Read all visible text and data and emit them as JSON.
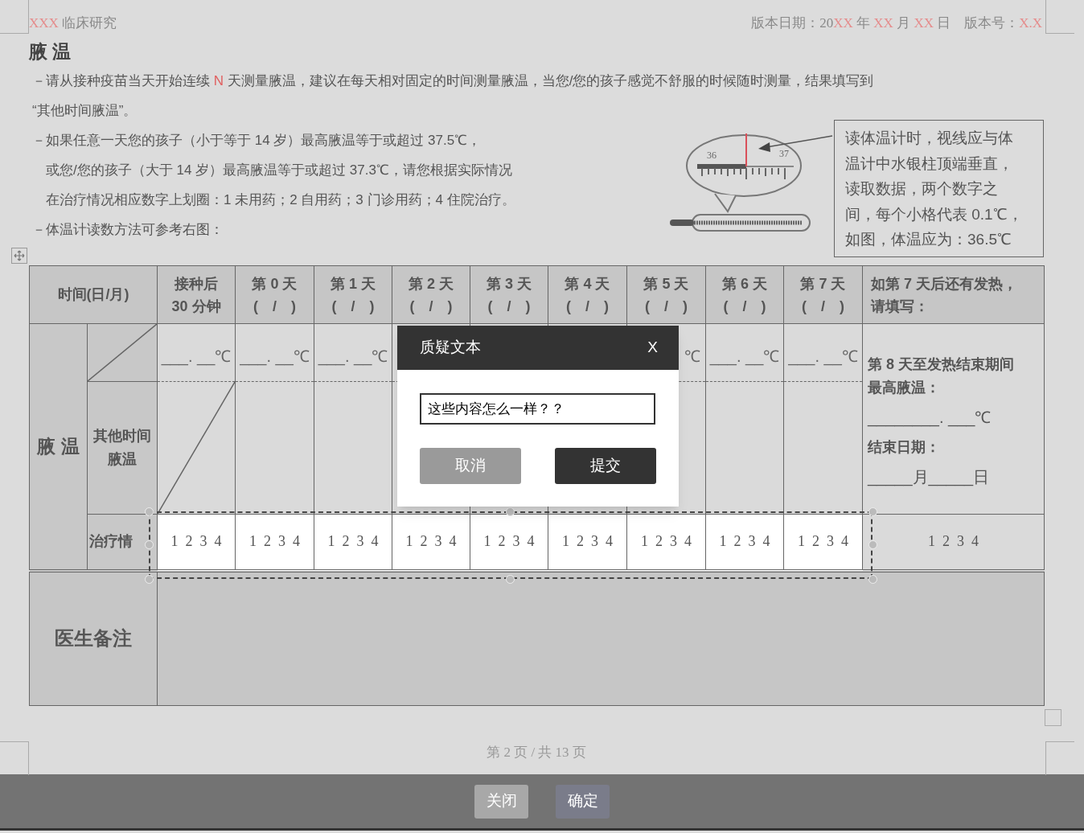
{
  "header": {
    "left": [
      {
        "text": "XXX",
        "highlight": true
      },
      {
        "text": " 临床研究",
        "highlight": false
      }
    ],
    "right": [
      {
        "text": "版本日期：20",
        "highlight": false
      },
      {
        "text": "XX",
        "highlight": true
      },
      {
        "text": " 年 ",
        "highlight": false
      },
      {
        "text": "XX",
        "highlight": true
      },
      {
        "text": " 月 ",
        "highlight": false
      },
      {
        "text": "XX",
        "highlight": true
      },
      {
        "text": " 日　版本号：",
        "highlight": false
      },
      {
        "text": "X.X",
        "highlight": true
      }
    ]
  },
  "title": "腋 温",
  "instructions": [
    {
      "segments": [
        {
          "text": "－请从接种疫苗当天开始连续 ",
          "highlight": false
        },
        {
          "text": "N",
          "highlight": true
        },
        {
          "text": " 天测量腋温，建议在每天相对固定的时间测量腋温，当您/您的孩子感觉不舒服的时候随时测量，结果填写到",
          "highlight": false
        }
      ]
    },
    {
      "segments": [
        {
          "text": "“其他时间腋温”。",
          "highlight": false
        }
      ]
    }
  ],
  "instructions_beside_figure": [
    {
      "lines": [
        "－如果任意一天您的孩子（小于等于 14 岁）最高腋温等于或超过 37.5℃，",
        "或您/您的孩子（大于 14 岁）最高腋温等于或超过 37.3℃，请您根据实际情况",
        "在治疗情况相应数字上划圈：1 未用药；2 自用药；3 门诊用药；4 住院治疗。"
      ]
    },
    {
      "lines": [
        "－体温计读数方法可参考右图："
      ]
    }
  ],
  "figure": {
    "scale_labels": [
      "36",
      "37"
    ],
    "note_lines": [
      "读体温计时，视线应与体",
      "温计中水银柱顶端垂直，",
      "读取数据，两个数字之",
      "间，每个小格代表 0.1℃，",
      "如图，体温应为：36.5℃"
    ]
  },
  "table": {
    "corner_header": "时间(日/月)",
    "day_columns": [
      {
        "title": "接种后",
        "subtitle": "30 分钟"
      },
      {
        "title": "第 0 天",
        "subtitle": "(　/　)"
      },
      {
        "title": "第 1 天",
        "subtitle": "(　/　)"
      },
      {
        "title": "第 2 天",
        "subtitle": "(　/　)"
      },
      {
        "title": "第 3 天",
        "subtitle": "(　/　)"
      },
      {
        "title": "第 4 天",
        "subtitle": "(　/　)"
      },
      {
        "title": "第 5 天",
        "subtitle": "(　/　)"
      },
      {
        "title": "第 6 天",
        "subtitle": "(　/　)"
      },
      {
        "title": "第 7 天",
        "subtitle": "(　/　)"
      }
    ],
    "extra_header": "如第 7 天后还有发热，请填写：",
    "section_label": "腋 温",
    "other_time_label": "其他时间腋温",
    "treatment_label": "治疗情",
    "temperature_cells": [
      {
        "kind": "full",
        "text": "___. __℃"
      },
      {
        "kind": "full",
        "text": "___. __℃"
      },
      {
        "kind": "full",
        "text": "___. __℃"
      },
      {
        "kind": "covered"
      },
      {
        "kind": "covered"
      },
      {
        "kind": "covered"
      },
      {
        "kind": "partial",
        "text": "℃"
      },
      {
        "kind": "full",
        "text": "___. __℃"
      },
      {
        "kind": "full",
        "text": "___. __℃"
      }
    ],
    "treatment_cells": [
      "1 2 3 4",
      "1 2 3 4",
      "1 2 3 4",
      "1 2 3 4",
      "1 2 3 4",
      "1 2 3 4",
      "1 2 3 4",
      "1 2 3 4",
      "1 2 3 4"
    ],
    "extra_lines": [
      "第 8 天至发热结束期间最高腋温：",
      "________. ___℃",
      "结束日期：",
      "_____月_____日"
    ],
    "extra_treatment": "1 2 3 4",
    "doctor_notes_label": "医生备注"
  },
  "page_footer": "第 2 页 / 共 13 页",
  "dialog": {
    "title": "质疑文本",
    "close": "X",
    "input_value": "这些内容怎么一样？？",
    "buttons": [
      {
        "label": "取消",
        "kind": "secondary"
      },
      {
        "label": "提交",
        "kind": "primary"
      }
    ]
  },
  "bottom_buttons": [
    {
      "label": "关闭",
      "kind": "secondary"
    },
    {
      "label": "确定",
      "kind": "primary"
    }
  ]
}
